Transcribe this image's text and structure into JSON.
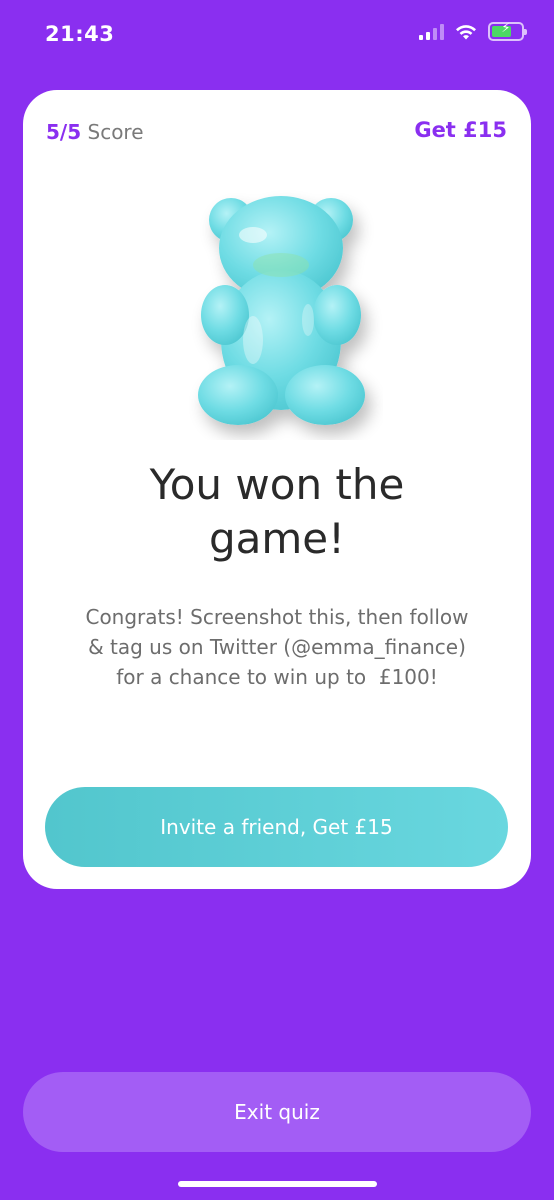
{
  "status_bar": {
    "time": "21:43",
    "icons": [
      "signal-icon",
      "wifi-icon",
      "battery-charging-icon"
    ]
  },
  "card": {
    "score_value": "5/5",
    "score_label": " Score",
    "get_link": "Get £15",
    "image": "gummy-bear-image",
    "headline_line1": "You won the",
    "headline_line2": "game!",
    "body_line1": "Congrats! Screenshot this, then follow",
    "body_line2": "& tag us on Twitter (@emma_finance)",
    "body_line3": "for a chance to win up to  £100!",
    "invite_button": "Invite a friend, Get £15"
  },
  "exit_button": "Exit quiz",
  "colors": {
    "background": "#8a2ff0",
    "accent": "#8a2ff0",
    "invite_button": "#5fcfd6",
    "exit_button": "#a35df5"
  }
}
